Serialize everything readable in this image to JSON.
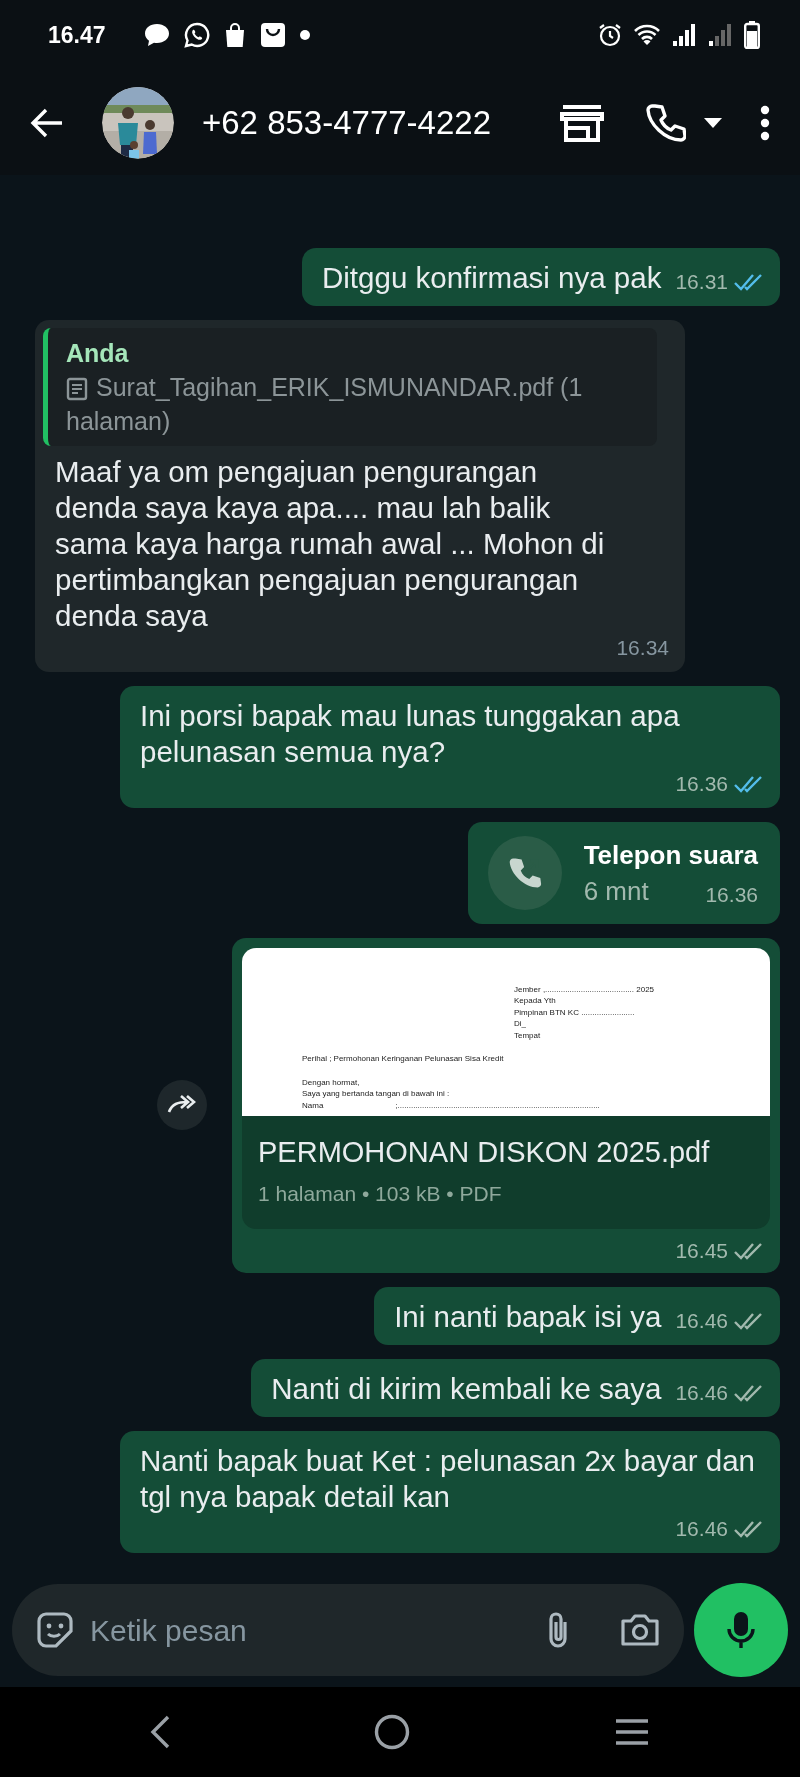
{
  "status_bar": {
    "time": "16.47"
  },
  "header": {
    "title": "+62 853-4777-4222"
  },
  "messages": [
    {
      "kind": "text",
      "outgoing": true,
      "text": "Ditggu konfirmasi nya pak",
      "time": "16.31",
      "read": true
    },
    {
      "kind": "text",
      "outgoing": false,
      "quote": {
        "author": "Anda",
        "text": "Surat_Tagihan_ERIK_ISMUNANDAR.pdf (1 halaman)"
      },
      "text": "Maaf ya om pengajuan pengurangan denda saya kaya apa.... mau lah balik sama kaya harga rumah awal ... Mohon di pertimbangkan pengajuan pengurangan denda saya",
      "time": "16.34"
    },
    {
      "kind": "text",
      "outgoing": true,
      "text": "Ini porsi bapak mau lunas tunggakan apa pelunasan semua nya?",
      "time": "16.36",
      "read": true
    },
    {
      "kind": "call",
      "outgoing": true,
      "title": "Telepon suara",
      "duration": "6 mnt",
      "time": "16.36"
    },
    {
      "kind": "document",
      "outgoing": true,
      "preview": {
        "header_lines": [
          "Jember ,........................................ 2025",
          "Kepada Yth",
          "Pimpinan BTN KC ........................",
          "Di_",
          "Tempat"
        ],
        "subject": "Perihal ; Permohonan Keringanan Pelunasan Sisa Kredit",
        "body_lines": [
          "Dengan hormat,",
          "Saya yang bertanda tangan di bawah ini :"
        ],
        "field": {
          "label": "Nama",
          "value": ";..........................................................................................."
        }
      },
      "file_name": "PERMOHONAN DISKON 2025.pdf",
      "meta": "1 halaman • 103 kB • PDF",
      "time": "16.45",
      "read": false
    },
    {
      "kind": "text",
      "outgoing": true,
      "text": "Ini nanti bapak isi ya",
      "time": "16.46",
      "read": false
    },
    {
      "kind": "text",
      "outgoing": true,
      "text": "Nanti di kirim kembali ke saya",
      "time": "16.46",
      "read": false
    },
    {
      "kind": "text",
      "outgoing": true,
      "text": "Nanti bapak buat Ket : pelunasan 2x bayar dan tgl nya bapak detail kan",
      "time": "16.46",
      "read": false
    }
  ],
  "input": {
    "placeholder": "Ketik pesan"
  }
}
